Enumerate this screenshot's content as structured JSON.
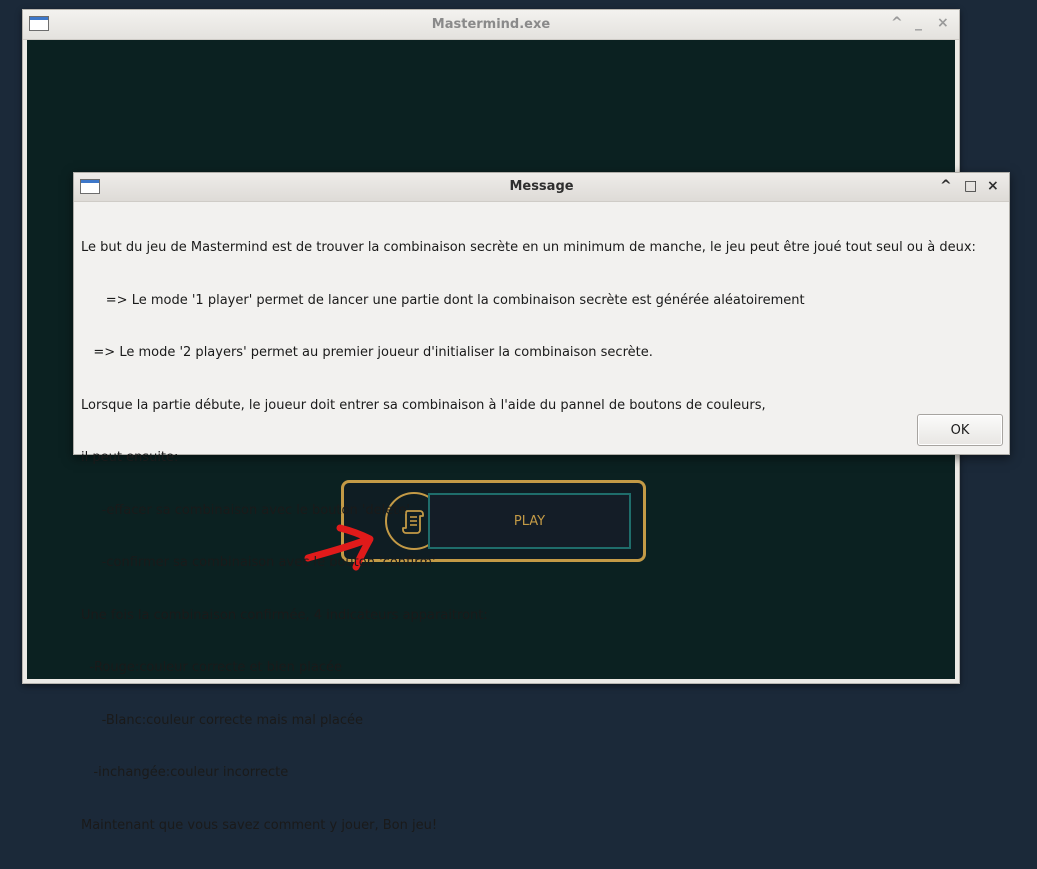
{
  "main_window": {
    "title": "Mastermind.exe",
    "controls": {
      "maximize": "^",
      "minimize": "_",
      "close": "×"
    }
  },
  "game": {
    "play_label": "PLAY",
    "rules_icon": "scroll-icon",
    "annotation_icon": "red-arrow-icon",
    "colors": {
      "background": "#0b2121",
      "gold": "#c39a46",
      "teal": "#1f6d6b"
    }
  },
  "dialog": {
    "title": "Message",
    "controls": {
      "maximize": "^",
      "restore": "□",
      "close": "×"
    },
    "lines": [
      "Le but du jeu de Mastermind est de trouver la combinaison secrète en un minimum de manche, le jeu peut être joué tout seul ou à deux:",
      "      => Le mode '1 player' permet de lancer une partie dont la combinaison secrète est générée aléatoirement",
      "   => Le mode '2 players' permet au premier joueur d'initialiser la combinaison secrète.",
      "Lorsque la partie débute, le joueur doit entrer sa combinaison à l'aide du pannel de boutons de couleurs,",
      "il peut ensuite:",
      "     -effacer sa combinaison avec le bouton 'delete'",
      "     -confirmer sa combinaison avec le bouton 'confirm'",
      "Une fois la combinaison confirmée, 4 indicateurs apparaitront:",
      "  -Rouge:couleur correcte et bien placée",
      "     -Blanc:couleur correcte mais mal placée",
      "   -inchangée:couleur incorrecte",
      "Maintenant que vous savez comment y jouer, Bon jeu!"
    ],
    "ok_label": "OK"
  }
}
